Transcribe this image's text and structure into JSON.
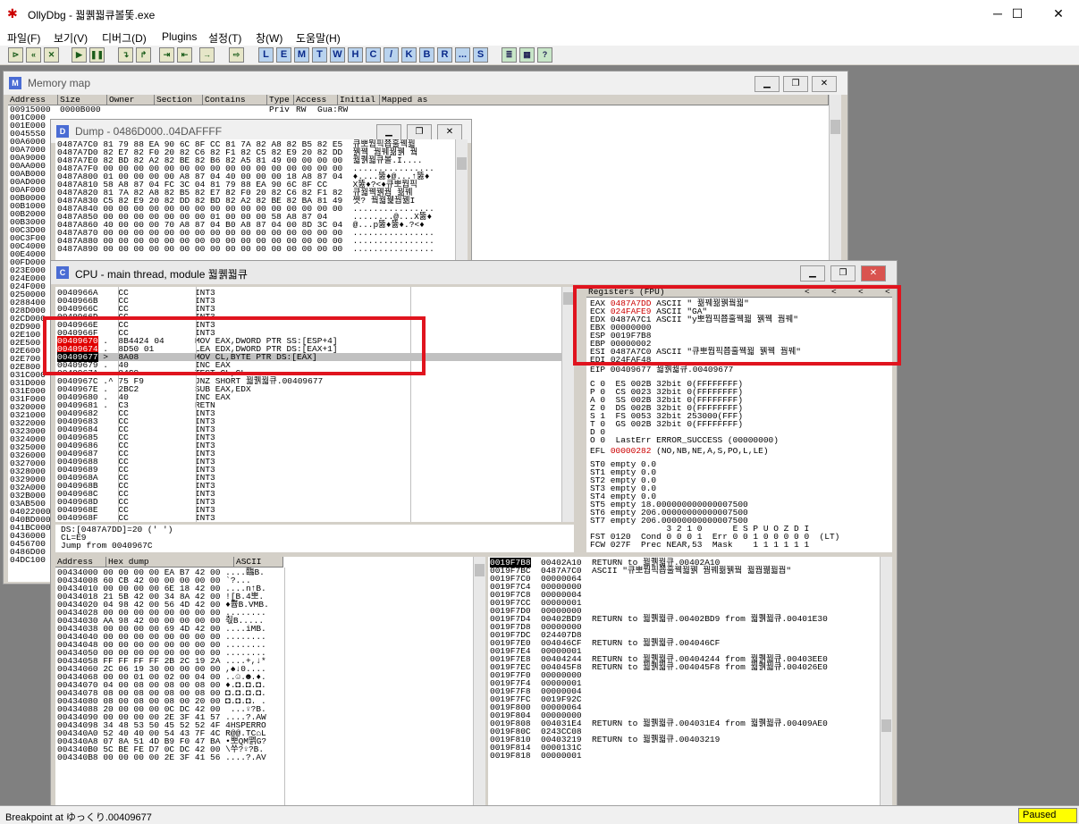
{
  "app": {
    "title": "OllyDbg - 꿟퀡꿟큐볼똧.exe",
    "minimize": "─",
    "maximize": "☐",
    "close": "✕",
    "icon": "bug-icon"
  },
  "menu": [
    "파일(F)",
    "보기(V)",
    "디버그(D)",
    "Plugins",
    "설정(T)",
    "창(W)",
    "도움말(H)"
  ],
  "toolbar": {
    "playback": [
      "⊳",
      "«",
      "✕",
      "▶",
      "❚❚",
      "↴",
      "↱",
      "⇥",
      "⇤",
      "→",
      "⇨"
    ],
    "letters": [
      "L",
      "E",
      "M",
      "T",
      "W",
      "H",
      "C",
      "/",
      "K",
      "B",
      "R",
      "...",
      "S"
    ],
    "config": [
      "≣",
      "▦",
      "?"
    ]
  },
  "memory_map": {
    "title": "Memory map",
    "icon_letter": "M",
    "columns": [
      "Address",
      "Size",
      "Owner",
      "Section",
      "Contains",
      "Type",
      "Access",
      "Initial",
      "Mapped as"
    ],
    "first_row": {
      "address": "00915000",
      "size": "0000B000",
      "type": "Priv",
      "access": "RW",
      "initial": "Gua:RW"
    },
    "addresses": [
      "001C000",
      "001E000",
      "00455S0",
      "00A6000",
      "00A7000",
      "00A9000",
      "00AA000",
      "00AB000",
      "00AD000",
      "00AF000",
      "00B0000",
      "00B1000",
      "00B2000",
      "00B3000",
      "00C3D00",
      "00C3F00",
      "00C4000",
      "00E4000",
      "00FD000",
      "023E000",
      "024E000",
      "024F000",
      "0250000",
      "0288400",
      "028D000",
      "02CD000",
      "02D900",
      "02E100",
      "02E500",
      "02E600",
      "02E700",
      "02E800",
      "031C000",
      "031D000",
      "031E000",
      "031F000",
      "0320000",
      "0321000",
      "0322000",
      "0323000",
      "0324000",
      "0325000",
      "0326000",
      "0327000",
      "0328000",
      "0329000",
      "032A000",
      "032B000",
      "03AB500",
      "04022000",
      "040BD000",
      "041BC000",
      "0436000",
      "0456700",
      "0486D00",
      "04DC100"
    ]
  },
  "dump": {
    "title": "Dump - 0486D000..04DAFFFF",
    "icon_letter": "D",
    "rows": [
      {
        "addr": "0487A7C0",
        "hex": "81 79 88 EA 90 6C 8F CC 81 7A 82 A8 82 B5 82 E5",
        "ascii": "큐뽀뭡픽쬽훌꿱꿟"
      },
      {
        "addr": "0487A7D0",
        "hex": "82 E7 82 F0 20 82 C6 82 F1 82 C5 82 E9 20 82 DD",
        "ascii": "꿹꿱 꿤꿰꿞꿹 꿬"
      },
      {
        "addr": "0487A7E0",
        "hex": "82 BD 82 A2 82 BE 82 B6 82 A5 81 49 00 00 00 00",
        "ascii": "꿟퀡꿟큐볼.I...."
      },
      {
        "addr": "0487A7F0",
        "hex": "00 00 00 00 00 00 00 00 00 00 00 00 00 00 00 00",
        "ascii": "................"
      },
      {
        "addr": "0487A800",
        "hex": "01 00 00 00 00 A8 87 04 40 00 00 00 18 A8 87 04",
        "ascii": "♦....뚫♦@...↑뚫♦"
      },
      {
        "addr": "0487A810",
        "hex": "58 A8 87 04 FC 3C 04 81 79 88 EA 90 6C 8F CC",
        "ascii": "X뚫♦?<♦큐뽀뭡픽"
      },
      {
        "addr": "0487A820",
        "hex": "81 7A 82 A8 82 B5 82 E7 82 F0 20 82 C6 82 F1 82",
        "ascii": "큐꿟꿱꿹꿤 꿞꿰"
      },
      {
        "addr": "0487A830",
        "hex": "C5 82 E9 20 82 DD 82 BD 82 A2 82 BE 82 BA 81 49",
        "ascii": "쪗? 꿬꿟꿽꿥꿺I"
      },
      {
        "addr": "0487A840",
        "hex": "00 00 00 00 00 00 00 00 00 00 00 00 00 00 00 00",
        "ascii": "................"
      },
      {
        "addr": "0487A850",
        "hex": "00 00 00 00 00 00 00 01 00 00 00 58 A8 87 04",
        "ascii": "........@...X뚫♦"
      },
      {
        "addr": "0487A860",
        "hex": "40 00 00 00 70 A8 87 04 B0 A8 87 04 00 8D 3C 04",
        "ascii": "@...p뚫♦뚫♦.?<♦"
      },
      {
        "addr": "0487A870",
        "hex": "00 00 00 00 00 00 00 00 00 00 00 00 00 00 00 00",
        "ascii": "................"
      },
      {
        "addr": "0487A880",
        "hex": "00 00 00 00 00 00 00 00 00 00 00 00 00 00 00 00",
        "ascii": "................"
      },
      {
        "addr": "0487A890",
        "hex": "00 00 00 00 00 00 00 00 00 00 00 00 00 00 00 00",
        "ascii": "................"
      }
    ]
  },
  "cpu": {
    "title": "CPU - main thread, module 꿟퀡꿟큐",
    "icon_letter": "C",
    "disasm": [
      {
        "addr": "0040966A",
        "mark": "",
        "bytes": "CC",
        "instr": "INT3",
        "state": "normal"
      },
      {
        "addr": "0040966B",
        "mark": "",
        "bytes": "CC",
        "instr": "INT3",
        "state": "normal"
      },
      {
        "addr": "0040966C",
        "mark": "",
        "bytes": "CC",
        "instr": "INT3",
        "state": "normal"
      },
      {
        "addr": "0040966D",
        "mark": "",
        "bytes": "CC",
        "instr": "INT3",
        "state": "normal"
      },
      {
        "addr": "0040966E",
        "mark": "",
        "bytes": "CC",
        "instr": "INT3",
        "state": "normal"
      },
      {
        "addr": "0040966F",
        "mark": "",
        "bytes": "CC",
        "instr": "INT3",
        "state": "normal"
      },
      {
        "addr": "00409670",
        "mark": ".",
        "bytes": "8B4424 04",
        "instr": "MOV EAX,DWORD PTR SS:[ESP+4]",
        "state": "breakpoint"
      },
      {
        "addr": "00409674",
        "mark": ".",
        "bytes": "8D50 01",
        "instr": "LEA EDX,DWORD PTR DS:[EAX+1]",
        "state": "breakpoint"
      },
      {
        "addr": "00409677",
        "mark": ">",
        "bytes": "8A08",
        "instr": "MOV CL,BYTE PTR DS:[EAX]",
        "state": "current"
      },
      {
        "addr": "00409679",
        "mark": ".",
        "bytes": "40",
        "instr": "INC EAX",
        "state": "normal"
      },
      {
        "addr": "0040967A",
        "mark": ".",
        "bytes": "84C9",
        "instr": "TEST CL,CL",
        "state": "normal"
      },
      {
        "addr": "0040967C",
        "mark": ".^",
        "bytes": "75 F9",
        "instr": "JNZ SHORT 꿟퀡꿟큐.00409677",
        "state": "normal"
      },
      {
        "addr": "0040967E",
        "mark": ".",
        "bytes": "2BC2",
        "instr": "SUB EAX,EDX",
        "state": "normal"
      },
      {
        "addr": "00409680",
        "mark": ".",
        "bytes": "40",
        "instr": "INC EAX",
        "state": "normal"
      },
      {
        "addr": "00409681",
        "mark": ".",
        "bytes": "C3",
        "instr": "RETN",
        "state": "normal"
      },
      {
        "addr": "00409682",
        "mark": "",
        "bytes": "CC",
        "instr": "INT3",
        "state": "normal"
      },
      {
        "addr": "00409683",
        "mark": "",
        "bytes": "CC",
        "instr": "INT3",
        "state": "normal"
      },
      {
        "addr": "00409684",
        "mark": "",
        "bytes": "CC",
        "instr": "INT3",
        "state": "normal"
      },
      {
        "addr": "00409685",
        "mark": "",
        "bytes": "CC",
        "instr": "INT3",
        "state": "normal"
      },
      {
        "addr": "00409686",
        "mark": "",
        "bytes": "CC",
        "instr": "INT3",
        "state": "normal"
      },
      {
        "addr": "00409687",
        "mark": "",
        "bytes": "CC",
        "instr": "INT3",
        "state": "normal"
      },
      {
        "addr": "00409688",
        "mark": "",
        "bytes": "CC",
        "instr": "INT3",
        "state": "normal"
      },
      {
        "addr": "00409689",
        "mark": "",
        "bytes": "CC",
        "instr": "INT3",
        "state": "normal"
      },
      {
        "addr": "0040968A",
        "mark": "",
        "bytes": "CC",
        "instr": "INT3",
        "state": "normal"
      },
      {
        "addr": "0040968B",
        "mark": "",
        "bytes": "CC",
        "instr": "INT3",
        "state": "normal"
      },
      {
        "addr": "0040968C",
        "mark": "",
        "bytes": "CC",
        "instr": "INT3",
        "state": "normal"
      },
      {
        "addr": "0040968D",
        "mark": "",
        "bytes": "CC",
        "instr": "INT3",
        "state": "normal"
      },
      {
        "addr": "0040968E",
        "mark": "",
        "bytes": "CC",
        "instr": "INT3",
        "state": "normal"
      },
      {
        "addr": "0040968F",
        "mark": "",
        "bytes": "CC",
        "instr": "INT3",
        "state": "normal"
      }
    ],
    "info": [
      "DS:[0487A7DD]=20 (' ')",
      "CL=E9",
      "Jump from 0040967C"
    ],
    "registers": {
      "header": "Registers (FPU)",
      "arrows": [
        "<",
        "<",
        "<",
        "<"
      ],
      "gp": [
        {
          "name": "EAX",
          "value": "0487A7DD",
          "changed": true,
          "note": "ASCII \" 꿞꿰꿞꿹꿬꿟\""
        },
        {
          "name": "ECX",
          "value": "024FAFE9",
          "changed": true,
          "note": "ASCII \"GA\""
        },
        {
          "name": "EDX",
          "value": "0487A7C1",
          "changed": false,
          "note": "ASCII \"y뽀뭡픽쬽훌꿱꿟 꿹꿱 꿤꿰\""
        },
        {
          "name": "EBX",
          "value": "00000000",
          "changed": false,
          "note": ""
        },
        {
          "name": "ESP",
          "value": "0019F7B8",
          "changed": false,
          "note": ""
        },
        {
          "name": "EBP",
          "value": "00000002",
          "changed": false,
          "note": ""
        },
        {
          "name": "ESI",
          "value": "0487A7C0",
          "changed": false,
          "note": "ASCII \"큐뽀뭡픽쬽훌꿱꿟 꿹꿱 꿤꿰\""
        },
        {
          "name": "EDI",
          "value": "024FAF48",
          "changed": false,
          "note": ""
        }
      ],
      "eip": "EIP 00409677 꿟퀡꿟큐.00409677",
      "flags": [
        "C 0  ES 002B 32bit 0(FFFFFFFF)",
        "P 0  CS 0023 32bit 0(FFFFFFFF)",
        "A 0  SS 002B 32bit 0(FFFFFFFF)",
        "Z 0  DS 002B 32bit 0(FFFFFFFF)",
        "S 1  FS 0053 32bit 253000(FFF)",
        "T 0  GS 002B 32bit 0(FFFFFFFF)",
        "D 0",
        "O 0  LastErr ERROR_SUCCESS (00000000)"
      ],
      "efl_label": "EFL",
      "efl_value": "00000282",
      "efl_note": "(NO,NB,NE,A,S,PO,L,LE)",
      "fpu": [
        "ST0 empty 0.0",
        "ST1 empty 0.0",
        "ST2 empty 0.0",
        "ST3 empty 0.0",
        "ST4 empty 0.0",
        "ST5 empty 18.000000000000007500",
        "ST6 empty 206.00000000000007500",
        "ST7 empty 206.00000000000007500",
        "               3 2 1 0      E S P U O Z D I",
        "FST 0120  Cond 0 0 0 1  Err 0 0 1 0 0 0 0 0  (LT)",
        "FCW 027F  Prec NEAR,53  Mask    1 1 1 1 1 1"
      ]
    },
    "hexdump": {
      "columns": [
        "Address",
        "Hex dump",
        "ASCII"
      ],
      "rows": [
        {
          "addr": "00434000",
          "hex": "00 00 00 00 EA B7 42 00",
          "ascii": "....臨B."
        },
        {
          "addr": "00434008",
          "hex": "60 CB 42 00 00 00 00 00",
          "ascii": "`?..."
        },
        {
          "addr": "00434010",
          "hex": "00 00 00 00 6E 18 42 00",
          "ascii": "....n↑B."
        },
        {
          "addr": "00434018",
          "hex": "21 5B 42 00 34 8A 42 00",
          "ascii": "![B.4뽀."
        },
        {
          "addr": "00434020",
          "hex": "04 98 42 00 56 4D 42 00",
          "ascii": "♦쁍B.VMB."
        },
        {
          "addr": "00434028",
          "hex": "00 00 00 00 00 00 00 00",
          "ascii": "........"
        },
        {
          "addr": "00434030",
          "hex": "AA 98 42 00 00 00 00 00",
          "ascii": "춳B....."
        },
        {
          "addr": "00434038",
          "hex": "00 00 00 00 69 4D 42 00",
          "ascii": "....iMB."
        },
        {
          "addr": "00434040",
          "hex": "00 00 00 00 00 00 00 00",
          "ascii": "........"
        },
        {
          "addr": "00434048",
          "hex": "00 00 00 00 00 00 00 00",
          "ascii": "........"
        },
        {
          "addr": "00434050",
          "hex": "00 00 00 00 00 00 00 00",
          "ascii": "........"
        },
        {
          "addr": "00434058",
          "hex": "FF FF FF FF 2B 2C 19 2A",
          "ascii": "....+,↓*"
        },
        {
          "addr": "00434060",
          "hex": "2C 06 19 30 00 00 00 00",
          "ascii": ",♠↓0...."
        },
        {
          "addr": "00434068",
          "hex": "00 00 01 00 02 00 04 00",
          "ascii": "..☺.☻.♦."
        },
        {
          "addr": "00434070",
          "hex": "04 00 08 00 08 00 08 00",
          "ascii": "♦.◘.◘.◘."
        },
        {
          "addr": "00434078",
          "hex": "08 00 08 00 08 00 08 00",
          "ascii": "◘.◘.◘.◘."
        },
        {
          "addr": "00434080",
          "hex": "08 00 08 00 08 00 20 00",
          "ascii": "◘.◘.◘. ."
        },
        {
          "addr": "00434088",
          "hex": "20 00 00 00 0C DC 42 00",
          "ascii": " ...♀?B."
        },
        {
          "addr": "00434090",
          "hex": "00 00 00 00 2E 3F 41 57",
          "ascii": "....?.AW"
        },
        {
          "addr": "00434098",
          "hex": "34 48 53 50 45 52 52 4F",
          "ascii": "4HSPERRO"
        },
        {
          "addr": "004340A0",
          "hex": "52 40 40 00 54 43 7F 4C",
          "ascii": "R@@.TC⌂L"
        },
        {
          "addr": "004340A8",
          "hex": "07 8A 51 4D B9 F0 47 BA",
          "ascii": "•뽀QM뗽G?"
        },
        {
          "addr": "004340B0",
          "hex": "5C BE FE D7 0C DC 42 00",
          "ascii": "\\쑤?♀?B."
        },
        {
          "addr": "004340B8",
          "hex": "00 00 00 00 2E 3F 41 56",
          "ascii": "....?.AV"
        }
      ]
    },
    "stack": {
      "rows": [
        {
          "addr": "0019F7B8",
          "value": "00402A10",
          "comment": "RETURN to 꿟퀡꿟큐.00402A10",
          "current": true
        },
        {
          "addr": "0019F7BC",
          "value": "0487A7C0",
          "comment": "ASCII \"큐뽀뭡픽쬽훌꿱꿟꿹 꿤꿰꿞꿹꿬 꿟꿥꿺꿟꿥\"",
          "current": false
        },
        {
          "addr": "0019F7C0",
          "value": "00000064",
          "comment": "",
          "current": false
        },
        {
          "addr": "0019F7C4",
          "value": "00000000",
          "comment": "",
          "current": false
        },
        {
          "addr": "0019F7C8",
          "value": "00000004",
          "comment": "",
          "current": false
        },
        {
          "addr": "0019F7CC",
          "value": "00000001",
          "comment": "",
          "current": false
        },
        {
          "addr": "0019F7D0",
          "value": "00000000",
          "comment": "",
          "current": false
        },
        {
          "addr": "0019F7D4",
          "value": "00402BD9",
          "comment": "RETURN to 꿟퀡꿟큐.00402BD9 from 꿟퀡꿟큐.00401E30",
          "current": false
        },
        {
          "addr": "0019F7D8",
          "value": "00000000",
          "comment": "",
          "current": false
        },
        {
          "addr": "0019F7DC",
          "value": "024407D8",
          "comment": "",
          "current": false
        },
        {
          "addr": "0019F7E0",
          "value": "004046CF",
          "comment": "RETURN to 꿟퀡꿟큐.004046CF",
          "current": false
        },
        {
          "addr": "0019F7E4",
          "value": "00000001",
          "comment": "",
          "current": false
        },
        {
          "addr": "0019F7E8",
          "value": "00404244",
          "comment": "RETURN to 꿟퀡꿟큐.00404244 from 꿟퀡꿟큐.00403EE0",
          "current": false
        },
        {
          "addr": "0019F7EC",
          "value": "004045F8",
          "comment": "RETURN to 꿟퀡꿟큐.004045F8 from 꿟퀡꿟큐.004026E0",
          "current": false
        },
        {
          "addr": "0019F7F0",
          "value": "00000000",
          "comment": "",
          "current": false
        },
        {
          "addr": "0019F7F4",
          "value": "00000001",
          "comment": "",
          "current": false
        },
        {
          "addr": "0019F7F8",
          "value": "00000004",
          "comment": "",
          "current": false
        },
        {
          "addr": "0019F7FC",
          "value": "0019F92C",
          "comment": "",
          "current": false
        },
        {
          "addr": "0019F800",
          "value": "00000064",
          "comment": "",
          "current": false
        },
        {
          "addr": "0019F804",
          "value": "00000000",
          "comment": "",
          "current": false
        },
        {
          "addr": "0019F808",
          "value": "004031E4",
          "comment": "RETURN to 꿟퀡꿟큐.004031E4 from 꿟퀡꿟큐.00409AE0",
          "current": false
        },
        {
          "addr": "0019F80C",
          "value": "0243CC08",
          "comment": "",
          "current": false
        },
        {
          "addr": "0019F810",
          "value": "00403219",
          "comment": "RETURN to 꿟퀡꿟큐.00403219",
          "current": false
        },
        {
          "addr": "0019F814",
          "value": "0000131C",
          "comment": "",
          "current": false
        },
        {
          "addr": "0019F818",
          "value": "00000001",
          "comment": "",
          "current": false
        }
      ]
    }
  },
  "status": {
    "text": "Breakpoint at ゆっくり.00409677",
    "state": "Paused",
    "state_color": "#ffff00"
  },
  "accent": {
    "annotation_red": "#e0141e",
    "breakpoint_red": "#e00000"
  }
}
